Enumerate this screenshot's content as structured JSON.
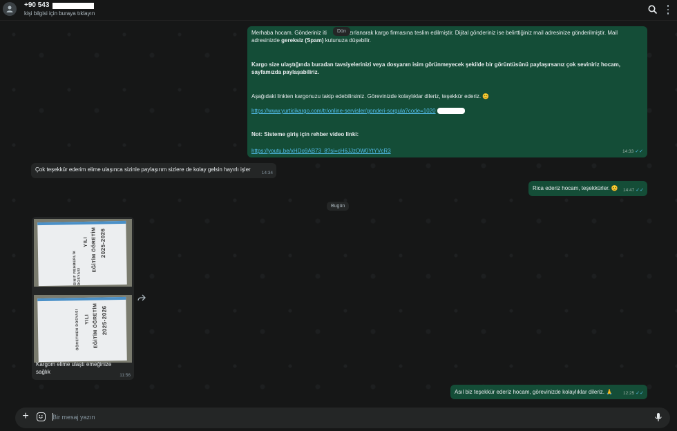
{
  "header": {
    "contact_name": "+90 543",
    "contact_subtitle": "kişi bilgisi için buraya tıklayın"
  },
  "messages": {
    "m1": {
      "line1a": "Merhaba hocam. Gönderiniz iti",
      "line1b": "azırlanarak kargo firmasına teslim edilmiştir. Dijital gönderiniz ise belirttiğiniz mail adresinize gönderilmiştir. Mail",
      "line2a": "adresinizde ",
      "line2b": "gereksiz (Spam)",
      "line2c": " kutunuza düşebilir.",
      "bold_para": "Kargo size ulaştığında buradan tavsiyelerinizi veya dosyanın isim görünmeyecek şekilde bir görüntüsünü paylaşırsanız çok seviniriz hocam, sayfamızda paylaşabiliriz.",
      "track_text": "Aşağıdaki linkten kargonuzu takip edebilirsiniz. Görevinizde kolaylıklar dileriz, teşekkür ederiz. 😊",
      "track_link": "https://www.yurticikargo.com/tr/online-servisler/gonderi-sorgula?code=1020",
      "note_bold": "Not: Sisteme giriş için rehber video linki:",
      "video_link": "https://youtu.be/xHDo9AB73_8?si=cH6JJzOW0YtYVcR3",
      "time": "14:33"
    },
    "m2": {
      "text": "Çok teşekkür ederim elime ulaşınca sizinle paylaşırım sizlere de kolay gelsin hayırlı işler",
      "time": "14:34"
    },
    "m3": {
      "text": "Rica ederiz hocam, teşekkürler. 😊",
      "time": "14:47"
    },
    "m4": {
      "caption": "Kargom elime ulaştı emeğinize sağlık",
      "time": "11:56"
    },
    "m5": {
      "text": "Asıl biz teşekkür ederiz hocam, görevinizde kolaylıklar dileriz. 🙏",
      "time": "12:25"
    }
  },
  "day_chips": {
    "yesterday": "Dün",
    "today": "Bugün"
  },
  "photo_text": {
    "year": "2025-2026",
    "title": "EĞİTİM ÖĞRETİM",
    "yil": "YILI",
    "file1": "SINIF REHBERLİK DOSYASI",
    "file2": "ÖĞRETMEN DOSYASI"
  },
  "composer": {
    "placeholder": "Bir mesaj yazın"
  },
  "colors": {
    "bubble_out": "#144d37",
    "bubble_in": "#242626",
    "link": "#53bdeb",
    "background": "#161717"
  },
  "icons": {
    "avatar": "person-icon",
    "search": "search-icon",
    "menu": "menu-icon",
    "plus": "plus-icon",
    "emoji": "emoji-icon",
    "mic": "mic-icon",
    "forward": "forward-icon"
  }
}
